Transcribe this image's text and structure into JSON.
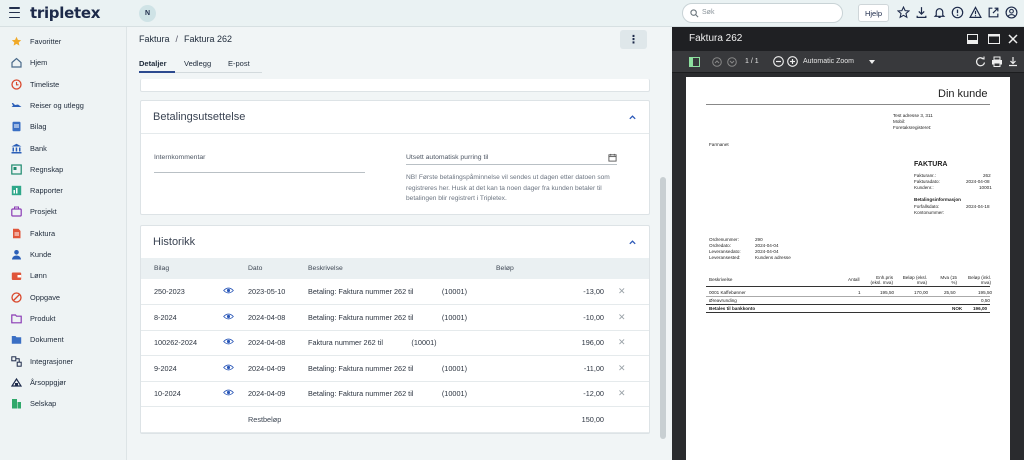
{
  "topbar": {
    "logo": "tripletex",
    "user_initial": "N",
    "search_placeholder": "Søk",
    "help_label": "Hjelp"
  },
  "sidebar": {
    "items": [
      {
        "label": "Favoritter",
        "icon": "star-icon",
        "color": "#f0a928"
      },
      {
        "label": "Hjem",
        "icon": "home-icon",
        "color": "#4a6a8a"
      },
      {
        "label": "Timeliste",
        "icon": "clock-icon",
        "color": "#d9472b"
      },
      {
        "label": "Reiser og utlegg",
        "icon": "plane-icon",
        "color": "#2b5fb8"
      },
      {
        "label": "Bilag",
        "icon": "document-icon",
        "color": "#3a6fc4"
      },
      {
        "label": "Bank",
        "icon": "bank-icon",
        "color": "#2b5fb8"
      },
      {
        "label": "Regnskap",
        "icon": "ledger-icon",
        "color": "#1d8a6d"
      },
      {
        "label": "Rapporter",
        "icon": "report-icon",
        "color": "#2fa88a"
      },
      {
        "label": "Prosjekt",
        "icon": "briefcase-icon",
        "color": "#8b3bb5"
      },
      {
        "label": "Faktura",
        "icon": "invoice-icon",
        "color": "#e0553a"
      },
      {
        "label": "Kunde",
        "icon": "customer-icon",
        "color": "#2b5fb8"
      },
      {
        "label": "Lønn",
        "icon": "wallet-icon",
        "color": "#e0553a"
      },
      {
        "label": "Oppgave",
        "icon": "task-icon",
        "color": "#d9472b"
      },
      {
        "label": "Produkt",
        "icon": "folder-icon",
        "color": "#8b3bb5"
      },
      {
        "label": "Dokument",
        "icon": "folder-doc-icon",
        "color": "#3a6fc4"
      },
      {
        "label": "Integrasjoner",
        "icon": "integration-icon",
        "color": "#1d2a4a"
      },
      {
        "label": "Årsoppgjør",
        "icon": "year-end-icon",
        "color": "#1d2a4a"
      },
      {
        "label": "Selskap",
        "icon": "company-icon",
        "color": "#2fa86a"
      }
    ]
  },
  "main": {
    "breadcrumb": [
      "Faktura",
      "Faktura 262"
    ],
    "tabs": [
      "Detaljer",
      "Vedlegg",
      "E-post"
    ],
    "betaling": {
      "title": "Betalingsutsettelse",
      "intern_label": "Internkommentar",
      "utsett_label": "Utsett automatisk purring til",
      "note": "NB! Første betalingspåminnelse vil sendes ut dagen etter datoen som registreres her. Husk at det kan ta noen dager fra kunden betaler til betalingen blir registrert i Tripletex."
    },
    "historikk": {
      "title": "Historikk",
      "columns": [
        "Bilag",
        "Dato",
        "Beskrivelse",
        "Beløp"
      ],
      "rows": [
        {
          "bilag": "250-2023",
          "dato": "2023-05-10",
          "beskrivelse": "Betaling: Faktura nummer 262 til",
          "kunde": "(10001)",
          "belop": "-13,00",
          "eye": true
        },
        {
          "bilag": "8-2024",
          "dato": "2024-04-08",
          "beskrivelse": "Betaling: Faktura nummer 262 til",
          "kunde": "(10001)",
          "belop": "-10,00",
          "eye": true
        },
        {
          "bilag": "100262-2024",
          "dato": "2024-04-08",
          "beskrivelse": "Faktura nummer 262 til",
          "kunde": "(10001)",
          "belop": "196,00",
          "eye": true
        },
        {
          "bilag": "9-2024",
          "dato": "2024-04-09",
          "beskrivelse": "Betaling: Faktura nummer 262 til",
          "kunde": "(10001)",
          "belop": "-11,00",
          "eye": true
        },
        {
          "bilag": "10-2024",
          "dato": "2024-04-09",
          "beskrivelse": "Betaling: Faktura nummer 262 til",
          "kunde": "(10001)",
          "belop": "-12,00",
          "eye": true
        }
      ],
      "rest_label": "Restbeløp",
      "rest_value": "150,00"
    }
  },
  "pdf": {
    "title": "Faktura 262",
    "page_indicator": "1 / 1",
    "zoom": "Automatic Zoom",
    "doc": {
      "kunde_heading": "Din kunde",
      "address": "Test adresse 3, 311",
      "mobil_label": "Mobil:",
      "foretak_label": "Foretaksregisteret:",
      "farmanet": "Farmanet",
      "faktura_heading": "FAKTURA",
      "fakturanr_label": "Fakturanr.:",
      "fakturanr": "262",
      "fakturadato_label": "Fakturadato:",
      "fakturadato": "2024-04-08",
      "kundenr_label": "Kundenr.:",
      "kundenr": "10001",
      "betalingsinfo_heading": "Betalingsinformasjon",
      "forfall_label": "Forfallsdato:",
      "forfall": "2024-04-18",
      "kontonr_label": "Kontonummer:",
      "ordre_labels": [
        "Ordrenummer:",
        "Ordredato:",
        "Leveransedato:",
        "Leveransested:"
      ],
      "ordre_values": [
        "290",
        "2024-04-04",
        "2024-04-04",
        "Kundens adresse"
      ],
      "cols": [
        "Beskrivelse",
        "Antall",
        "Enh.pris (eksl. mva)",
        "Beløp (eksl. mva)",
        "Mva (15 %)",
        "Beløp (inkl. mva)"
      ],
      "line_item": [
        "0001 Kaffebønner",
        "1",
        "195,50",
        "170,00",
        "25,50",
        "195,50"
      ],
      "ore_label": "Øreavrunding",
      "ore_value": "0,50",
      "total_label": "Betales til bankkonto",
      "total_currency": "NOK",
      "total_value": "196,00"
    }
  }
}
